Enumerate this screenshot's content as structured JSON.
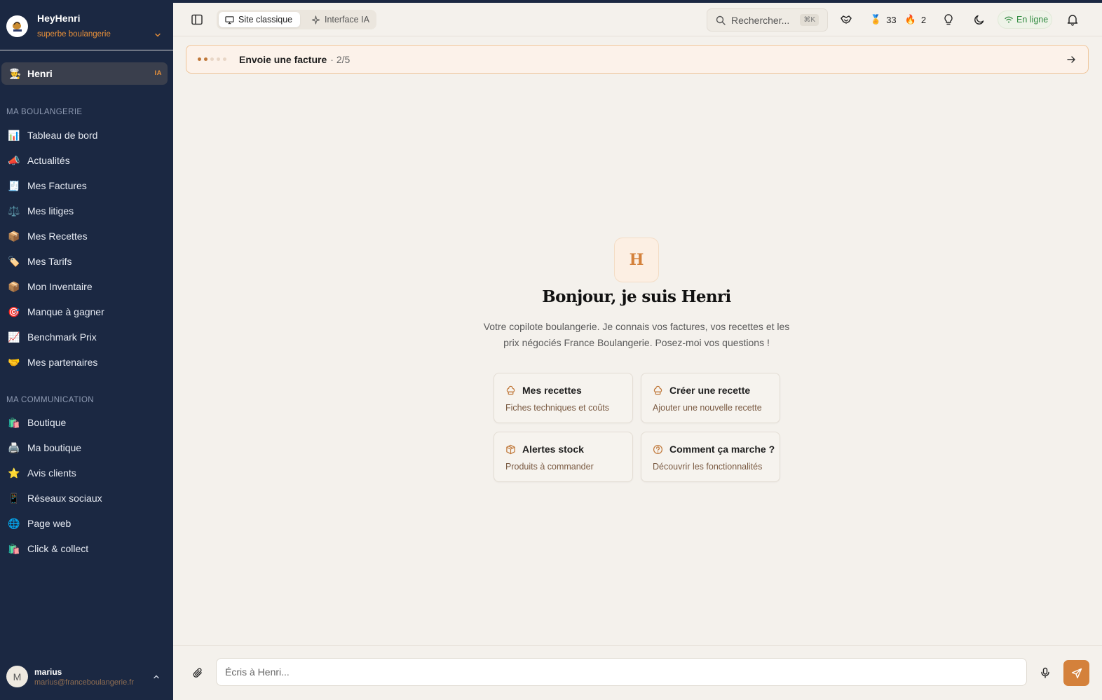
{
  "brand": {
    "name": "HeyHenri",
    "subtitle": "superbe boulangerie"
  },
  "assistant_item": {
    "emoji": "👨‍🍳",
    "label": "Henri",
    "badge": "IA"
  },
  "sidebar": {
    "section1": {
      "title": "Ma boulangerie",
      "items": [
        {
          "emoji": "📊",
          "label": "Tableau de bord"
        },
        {
          "emoji": "📣",
          "label": "Actualités"
        },
        {
          "emoji": "🧾",
          "label": "Mes Factures"
        },
        {
          "emoji": "⚖️",
          "label": "Mes litiges"
        },
        {
          "emoji": "📦",
          "label": "Mes Recettes"
        },
        {
          "emoji": "🏷️",
          "label": "Mes Tarifs"
        },
        {
          "emoji": "📦",
          "label": "Mon Inventaire"
        },
        {
          "emoji": "🎯",
          "label": "Manque à gagner"
        },
        {
          "emoji": "📈",
          "label": "Benchmark Prix"
        },
        {
          "emoji": "🤝",
          "label": "Mes partenaires"
        }
      ]
    },
    "section2": {
      "title": "Ma communication",
      "items": [
        {
          "emoji": "🛍️",
          "label": "Boutique"
        },
        {
          "emoji": "🖨️",
          "label": "Ma boutique"
        },
        {
          "emoji": "⭐",
          "label": "Avis clients"
        },
        {
          "emoji": "📱",
          "label": "Réseaux sociaux"
        },
        {
          "emoji": "🌐",
          "label": "Page web"
        },
        {
          "emoji": "🛍️",
          "label": "Click & collect"
        }
      ]
    }
  },
  "user": {
    "initial": "M",
    "name": "marius",
    "email": "marius@franceboulangerie.fr"
  },
  "header": {
    "mode_classic": "Site classique",
    "mode_ai": "Interface IA",
    "search_placeholder": "Rechercher...",
    "search_shortcut": "⌘K",
    "medal_emoji": "🏅",
    "points": "33",
    "streak_emoji": "🔥",
    "streak": "2",
    "status": "En ligne"
  },
  "task_banner": {
    "task": "Envoie une facture",
    "progress": "· 2/5",
    "steps_total": 5,
    "steps_done": 2
  },
  "hero": {
    "mark": "H",
    "title": "Bonjour, je suis Henri",
    "text": "Votre copilote boulangerie. Je connais vos factures, vos recettes et les prix négociés France Boulangerie. Posez-moi vos questions !"
  },
  "suggestions": [
    {
      "icon": "chef-hat-icon",
      "title": "Mes recettes",
      "subtitle": "Fiches techniques et coûts"
    },
    {
      "icon": "chef-hat-icon",
      "title": "Créer une recette",
      "subtitle": "Ajouter une nouvelle recette"
    },
    {
      "icon": "package-icon",
      "title": "Alertes stock",
      "subtitle": "Produits à commander"
    },
    {
      "icon": "help-circle-icon",
      "title": "Comment ça marche ?",
      "subtitle": "Découvrir les fonctionnalités"
    }
  ],
  "composer": {
    "placeholder": "Écris à Henri..."
  },
  "colors": {
    "sidebar": "#1b2842",
    "accent": "#d4813b",
    "background": "#f4f1ec",
    "online": "#2f8a3f"
  }
}
